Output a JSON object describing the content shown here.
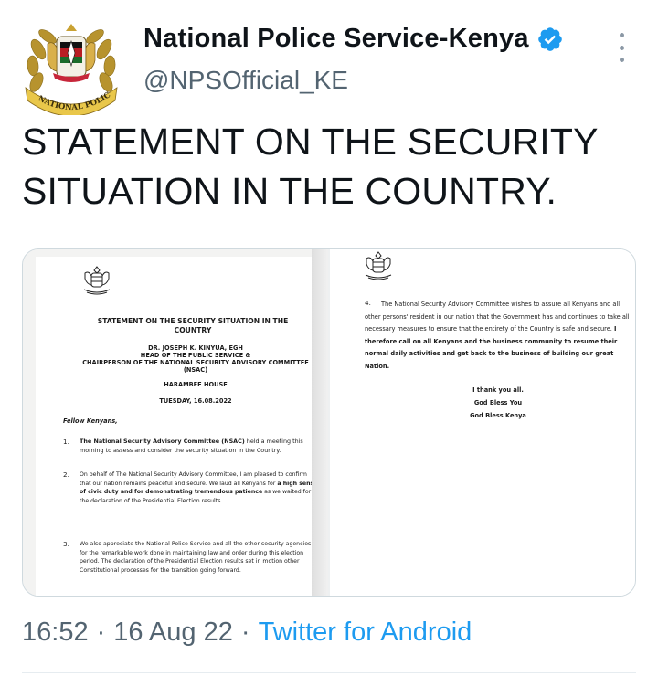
{
  "account": {
    "display_name": "National Police Service-Kenya",
    "handle": "@NPSOfficial_KE",
    "avatar_ribbon_text": "NATIONAL POLICE SERVICE",
    "verified_icon": "verified-badge-icon",
    "more_icon": "more-vertical-icon"
  },
  "tweet": {
    "text": "STATEMENT ON THE SECURITY SITUATION IN THE COUNTRY."
  },
  "document_page1": {
    "title": "STATEMENT ON THE SECURITY SITUATION IN THE COUNTRY",
    "author_name": "DR. JOSEPH K. KINYUA, EGH",
    "author_role1": "HEAD OF THE PUBLIC SERVICE &",
    "author_role2": "CHAIRPERSON OF THE NATIONAL SECURITY ADVISORY COMMITTEE",
    "author_role3": "(NSAC)",
    "place": "HARAMBEE HOUSE",
    "date": "TUESDAY, 16.08.2022",
    "salutation": "Fellow Kenyans,",
    "p1_num": "1.",
    "p1_bold": "The National Security Advisory Committee (NSAC)",
    "p1_rest": "held a meeting this morning to assess and consider the security situation in the Country.",
    "p2_num": "2.",
    "p2_text_a": "On behalf of The National Security Advisory Committee, I am pleased to confirm that our nation remains peaceful and secure. We laud all Kenyans for",
    "p2_bold": "a high sense of civic duty and for demonstrating tremendous patience",
    "p2_text_b": "as we waited for the declaration of the Presidential Election results.",
    "p3_num": "3.",
    "p3_text": "We also appreciate the National Police Service and all the other security agencies for the remarkable work done in maintaining law and order during this election period. The declaration of the Presidential Election results set in motion other Constitutional processes for the transition going forward."
  },
  "document_page2": {
    "p4_num": "4.",
    "p4_text": "The National Security Advisory Committee wishes to assure all Kenyans and all other persons' resident in our nation that the Government has and continues to take all necessary measures to ensure that the entirety of the Country is safe and secure.",
    "p4_bold": "I therefore call on all Kenyans and the business community to resume their normal daily activities and get back to the business of building our great Nation.",
    "closing1": "I thank you all.",
    "closing2": "God Bless You",
    "closing3": "God Bless Kenya"
  },
  "footer": {
    "time": "16:52",
    "sep1": "·",
    "date": "16 Aug 22",
    "sep2": "·",
    "source": "Twitter for Android"
  },
  "colors": {
    "text": "#0f1419",
    "secondary": "#536471",
    "link": "#1d9bf0",
    "verified": "#1d9bf0",
    "border": "#cfd9de"
  }
}
